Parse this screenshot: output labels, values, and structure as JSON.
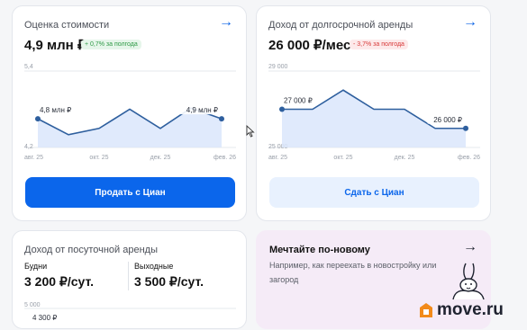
{
  "cards": {
    "valuation": {
      "title": "Оценка стоимости",
      "value": "4,9 млн ₽",
      "badge": "+ 0,7% за полгода",
      "button": "Продать с Циан"
    },
    "long_rent": {
      "title": "Доход от долгосрочной аренды",
      "value": "26 000 ₽/мес",
      "badge": "- 3,7% за полгода",
      "button": "Сдать с Циан"
    },
    "daily_rent": {
      "title": "Доход от посуточной аренды",
      "weekdays_label": "Будни",
      "weekdays_value": "3 200 ₽/сут.",
      "weekend_label": "Выходные",
      "weekend_value": "3 500 ₽/сут."
    },
    "promo": {
      "title": "Мечтайте по-новому",
      "text": "Например, как переехать в новостройку или загород"
    }
  },
  "logo": "move.ru",
  "colors": {
    "accent": "#0b66eb",
    "line": "#2e5f9e",
    "area": "#dbe6fb",
    "positive": "#2e9a46",
    "negative": "#d83a3a",
    "promo_bg": "#f5ebf7"
  },
  "chart_data": [
    {
      "type": "area",
      "x": [
        "авг. 25",
        "",
        "окт. 25",
        "",
        "дек. 25",
        "",
        "фев. 26"
      ],
      "tick_labels": [
        "авг. 25",
        "окт. 25",
        "дек. 25",
        "фев. 26"
      ],
      "values": [
        4.65,
        4.4,
        4.5,
        4.8,
        4.5,
        4.82,
        4.65
      ],
      "ylim": [
        4.2,
        5.4
      ],
      "y_tick_labels": [
        "5,4",
        "4,2"
      ],
      "annotations": [
        {
          "index": 0,
          "text": "4,8 млн ₽"
        },
        {
          "index": 6,
          "text": "4,9 млн ₽"
        }
      ]
    },
    {
      "type": "area",
      "x": [
        "авг. 25",
        "",
        "окт. 25",
        "",
        "дек. 25",
        "",
        "фев. 26"
      ],
      "tick_labels": [
        "авг. 25",
        "окт. 25",
        "дек. 25",
        "фев. 26"
      ],
      "values": [
        27000,
        27000,
        28000,
        27000,
        27000,
        26000,
        26000
      ],
      "ylim": [
        25000,
        29000
      ],
      "y_tick_labels": [
        "29 000",
        "25 000"
      ],
      "annotations": [
        {
          "index": 0,
          "text": "27 000 ₽"
        },
        {
          "index": 6,
          "text": "26 000 ₽"
        }
      ]
    },
    {
      "type": "area",
      "y_tick_labels": [
        "5 000"
      ],
      "annotations": [
        {
          "text": "4 300 ₽"
        }
      ]
    }
  ]
}
